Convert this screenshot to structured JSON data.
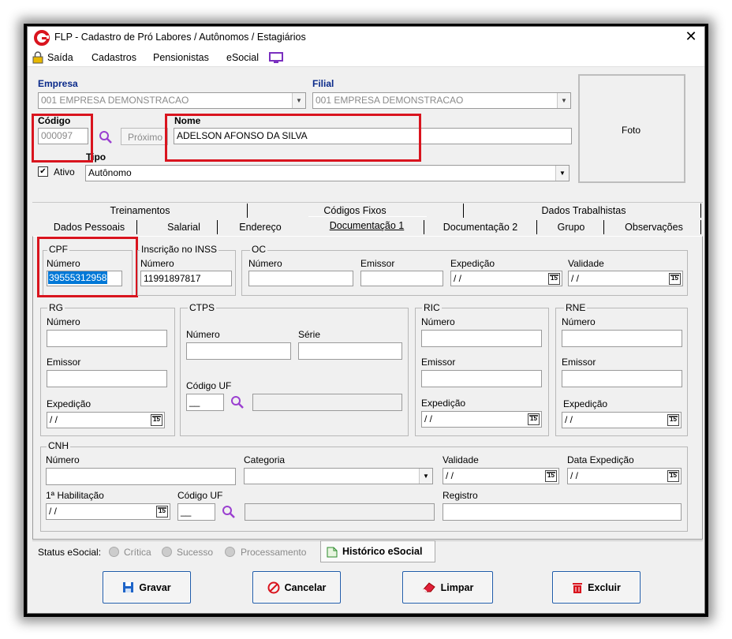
{
  "window": {
    "title": "FLP - Cadastro de Pró Labores / Autônomos / Estagiários",
    "close": "✕"
  },
  "menu": {
    "exit": "Saída",
    "items": [
      "Cadastros",
      "Pensionistas",
      "eSocial"
    ]
  },
  "header": {
    "empresa_label": "Empresa",
    "empresa_value": "001 EMPRESA DEMONSTRACAO",
    "filial_label": "Filial",
    "filial_value": "001 EMPRESA DEMONSTRACAO",
    "codigo_label": "Código",
    "codigo_value": "000097",
    "proximo": "Próximo",
    "nome_label": "Nome",
    "nome_value": "ADELSON AFONSO DA SILVA",
    "ativo_label": "Ativo",
    "tipo_label": "Tipo",
    "tipo_value": "Autônomo",
    "foto": "Foto"
  },
  "tabs": {
    "row1": [
      "Treinamentos",
      "Códigos Fixos",
      "Dados Trabalhistas"
    ],
    "row2": [
      "Dados Pessoais",
      "Salarial",
      "Endereço",
      "Documentação 1",
      "Documentação 2",
      "Grupo",
      "Observações"
    ]
  },
  "cpf": {
    "title": "CPF",
    "numero_label": "Número",
    "numero_value": "39555312958"
  },
  "inss": {
    "title": "Inscrição no INSS",
    "numero_label": "Número",
    "numero_value": "11991897817"
  },
  "oc": {
    "title": "OC",
    "numero": "Número",
    "emissor": "Emissor",
    "expedicao": "Expedição",
    "validade": "Validade",
    "expedicao_value": " / /",
    "validade_value": " / /"
  },
  "rg": {
    "title": "RG",
    "numero": "Número",
    "emissor": "Emissor",
    "expedicao": "Expedição",
    "expedicao_value": " / /"
  },
  "ctps": {
    "title": "CTPS",
    "numero": "Número",
    "serie": "Série",
    "codigo_uf": "Código UF",
    "uf_value": "__"
  },
  "ric": {
    "title": "RIC",
    "numero": "Número",
    "emissor": "Emissor",
    "expedicao": "Expedição",
    "expedicao_value": " / /"
  },
  "rne": {
    "title": "RNE",
    "numero": "Número",
    "emissor": "Emissor",
    "expedicao": "Expedição",
    "expedicao_value": " / /"
  },
  "cnh": {
    "title": "CNH",
    "numero": "Número",
    "categoria": "Categoria",
    "validade": "Validade",
    "data_expedicao": "Data Expedição",
    "habilitacao": "1ª Habilitação",
    "codigo_uf": "Código UF",
    "registro": "Registro",
    "date_value": " / /",
    "uf_value": "__"
  },
  "status": {
    "label": "Status eSocial:",
    "critica": "Crítica",
    "sucesso": "Sucesso",
    "processamento": "Processamento",
    "historico": "Histórico eSocial"
  },
  "buttons": {
    "gravar": "Gravar",
    "cancelar": "Cancelar",
    "limpar": "Limpar",
    "excluir": "Excluir"
  },
  "cal_icon_text": "15",
  "colors": {
    "highlight_box": "#d9141e",
    "selection": "#0078d7",
    "label_blue": "#0a2a8a"
  }
}
